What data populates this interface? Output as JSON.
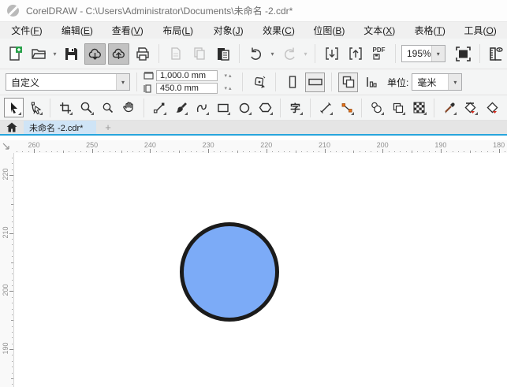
{
  "title_bar": {
    "title": "CorelDRAW - C:\\Users\\Administrator\\Documents\\未命名 -2.cdr*"
  },
  "menu_bar": {
    "items": [
      {
        "text": "文件",
        "key": "F"
      },
      {
        "text": "编辑",
        "key": "E"
      },
      {
        "text": "查看",
        "key": "V"
      },
      {
        "text": "布局",
        "key": "L"
      },
      {
        "text": "对象",
        "key": "J"
      },
      {
        "text": "效果",
        "key": "C"
      },
      {
        "text": "位图",
        "key": "B"
      },
      {
        "text": "文本",
        "key": "X"
      },
      {
        "text": "表格",
        "key": "T"
      },
      {
        "text": "工具",
        "key": "O"
      }
    ]
  },
  "toolbar": {
    "zoom_value": "195%",
    "pdf_label": "PDF"
  },
  "property_bar": {
    "preset_value": "自定义",
    "page_width": "1,000.0 mm",
    "page_height": "450.0 mm",
    "units_label": "单位:",
    "units_value": "毫米"
  },
  "toolbox": {
    "text_tool_glyph": "字"
  },
  "document_tabs": {
    "active_tab": "未命名 -2.cdr*",
    "new_tab_label": "+"
  },
  "rulers": {
    "horizontal_labels": [
      260,
      250,
      240,
      230,
      220,
      210,
      200,
      190,
      180
    ],
    "vertical_labels": [
      220,
      210,
      200,
      190
    ]
  },
  "canvas": {
    "circle": {
      "fill": "#7cabf7",
      "stroke": "#1b1b1b"
    }
  },
  "icons": {
    "caret_down": "▾",
    "caret_up": "▴"
  },
  "colors": {
    "tab_accent": "#27a5dd",
    "active_tab_bg": "#cfe4f6",
    "pressed_button_bg": "#c2c2c2",
    "new_doc_plus": "#2ba24c",
    "connector_node": "#e8731a",
    "fill_tool_red": "#d22b1f"
  }
}
